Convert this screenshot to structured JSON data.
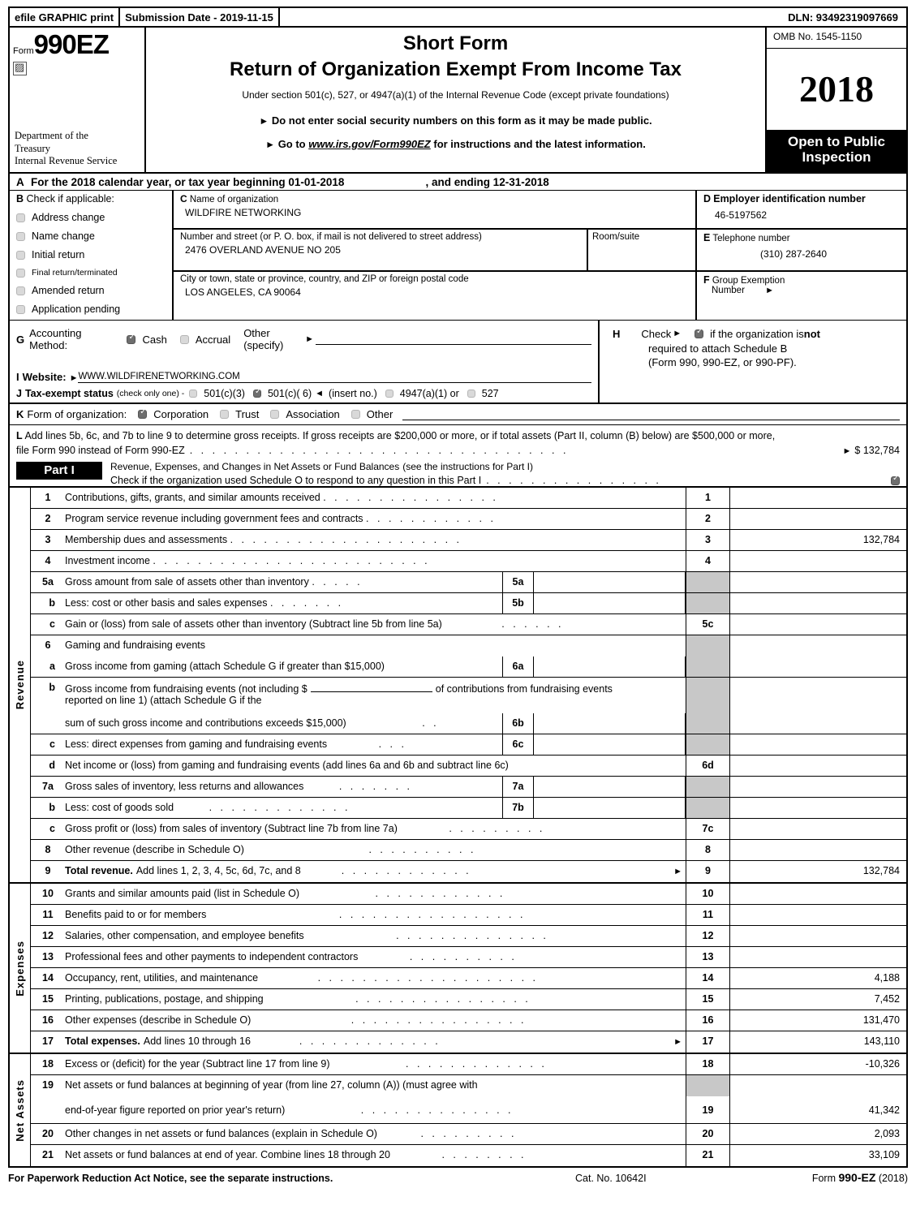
{
  "efile": {
    "print_label": "efile GRAPHIC print",
    "submission": "Submission Date - 2019-11-15",
    "dln": "DLN: 93492319097669"
  },
  "header": {
    "form_label": "Form",
    "form_number": "990EZ",
    "dept_line1": "Department of the",
    "dept_line2": "Treasury",
    "dept_line3": "Internal Revenue Service",
    "title_short": "Short Form",
    "title_main": "Return of Organization Exempt From Income Tax",
    "subtitle": "Under section 501(c), 527, or 4947(a)(1) of the Internal Revenue Code (except private foundations)",
    "bullet1": "Do not enter social security numbers on this form as it may be made public.",
    "bullet2_pre": "Go to ",
    "bullet2_link": "www.irs.gov/Form990EZ",
    "bullet2_post": " for instructions and the latest information.",
    "omb": "OMB No. 1545-1150",
    "year": "2018",
    "open_line1": "Open to Public",
    "open_line2": "Inspection"
  },
  "rowA": {
    "letter": "A",
    "text": "For the 2018 calendar year, or tax year beginning 01-01-2018",
    "ending": ", and ending 12-31-2018"
  },
  "sectionB": {
    "letter": "B",
    "heading": "Check if applicable:",
    "items": [
      {
        "label": "Address change",
        "checked": false
      },
      {
        "label": "Name change",
        "checked": false
      },
      {
        "label": "Initial return",
        "checked": false
      },
      {
        "label": "Final return/terminated",
        "checked": false
      },
      {
        "label": "Amended return",
        "checked": false
      },
      {
        "label": "Application pending",
        "checked": false
      }
    ]
  },
  "sectionC": {
    "letter": "C",
    "name_label": "Name of organization",
    "name_value": "WILDFIRE NETWORKING",
    "street_label": "Number and street (or P. O. box, if mail is not delivered to street address)",
    "street_value": "2476 OVERLAND AVENUE NO 205",
    "room_label": "Room/suite",
    "room_value": "",
    "city_label": "City or town, state or province, country, and ZIP or foreign postal code",
    "city_value": "LOS ANGELES, CA   90064"
  },
  "sectionD": {
    "letter": "D",
    "ein_label": "Employer identification number",
    "ein_value": "46-5197562",
    "phone_letter": "E",
    "phone_label": "Telephone number",
    "phone_value": "(310) 287-2640",
    "group_letter": "F",
    "group_label1": "Group Exemption",
    "group_label2": "Number"
  },
  "sectionG": {
    "letter": "G",
    "label": "Accounting Method:",
    "cash": "Cash",
    "cash_checked": true,
    "accrual": "Accrual",
    "accrual_checked": false,
    "other": "Other (specify)"
  },
  "sectionI": {
    "letter": "I",
    "label": "Website:",
    "value": "WWW.WILDFIRENETWORKING.COM"
  },
  "sectionJ": {
    "letter": "J",
    "label": "Tax-exempt status",
    "note": "(check only one) -",
    "opt1": "501(c)(3)",
    "opt1_checked": false,
    "opt2": "501(c)( 6)",
    "opt2_checked": true,
    "insert": "(insert no.)",
    "opt3": "4947(a)(1) or",
    "opt3_checked": false,
    "opt4": "527",
    "opt4_checked": false
  },
  "sectionH": {
    "letter": "H",
    "check_label": "Check",
    "checked": true,
    "line1_post": "if the organization is ",
    "line1_bold": "not",
    "line2": "required to attach Schedule B",
    "line3": "(Form 990, 990-EZ, or 990-PF)."
  },
  "sectionK": {
    "letter": "K",
    "label": "Form of organization:",
    "options": [
      {
        "label": "Corporation",
        "checked": true
      },
      {
        "label": "Trust",
        "checked": false
      },
      {
        "label": "Association",
        "checked": false
      },
      {
        "label": "Other",
        "checked": false
      }
    ]
  },
  "sectionL": {
    "letter": "L",
    "line1": "Add lines 5b, 6c, and 7b to line 9 to determine gross receipts. If gross receipts are $200,000 or more, or if total assets (Part II, column (B) below) are $500,000 or more,",
    "line2": "file Form 990 instead of Form 990-EZ",
    "amount": "$ 132,784"
  },
  "partI": {
    "label": "Part I",
    "title": "Revenue, Expenses, and Changes in Net Assets or Fund Balances",
    "title_note": "(see the instructions for Part I)",
    "schedule_o": "Check if the organization used Schedule O to respond to any question in this Part I",
    "schedule_o_checked": true,
    "revenue_label": "Revenue",
    "expenses_label": "Expenses",
    "netassets_label": "Net Assets"
  },
  "lines": {
    "revenue": [
      {
        "no": "1",
        "indent": false,
        "text": "Contributions, gifts, grants, and similar amounts received",
        "dots": ". . . . . . . . . . . . . . . .",
        "numcol": "1",
        "value": ""
      },
      {
        "no": "2",
        "indent": false,
        "text": "Program service revenue including government fees and contracts",
        "dots": ". . . . . . . . . . . .",
        "numcol": "2",
        "value": ""
      },
      {
        "no": "3",
        "indent": false,
        "text": "Membership dues and assessments",
        "dots": ". . . . . . . . . . . . . . . . . . . . .",
        "numcol": "3",
        "value": "132,784"
      },
      {
        "no": "4",
        "indent": false,
        "text": "Investment income",
        "dots": ". . . . . . . . . . . . . . . . . . . . . . . . .",
        "numcol": "4",
        "value": ""
      },
      {
        "no": "5a",
        "indent": false,
        "text": "Gross amount from sale of assets other than inventory",
        "dots": ". . . . .",
        "subnum": "5a",
        "subval": "",
        "numcol": "",
        "grey": true,
        "value": ""
      },
      {
        "no": "b",
        "indent": true,
        "text": "Less: cost or other basis and sales expenses",
        "dots": ". . . . . . .",
        "subnum": "5b",
        "subval": "",
        "numcol": "",
        "grey": true,
        "value": ""
      },
      {
        "no": "c",
        "indent": true,
        "text": "Gain or (loss) from sale of assets other than inventory (Subtract line 5b from line 5a)",
        "dots": ". . . . . .",
        "numcol": "5c",
        "value": ""
      },
      {
        "no": "6",
        "indent": false,
        "text": "Gaming and fundraising events",
        "dots": "",
        "numcol": "",
        "grey": true,
        "value": ""
      },
      {
        "no": "a",
        "indent": true,
        "text": "Gross income from gaming (attach Schedule G if greater than $15,000)",
        "dots": "",
        "subnum": "6a",
        "subval": "",
        "numcol": "",
        "grey": true,
        "value": ""
      },
      {
        "no": "b",
        "indent": true,
        "text": "Gross income from fundraising events (not including $ ____ of contributions from fundraising events reported on line 1) (attach Schedule G if the",
        "dots": "",
        "numcol": "",
        "grey": true,
        "value": "",
        "special": "6b-head"
      },
      {
        "no": "",
        "indent": true,
        "text": "sum of such gross income and contributions exceeds $15,000)",
        "dots": ". .",
        "subnum": "6b",
        "subval": "",
        "numcol": "",
        "grey": true,
        "value": ""
      },
      {
        "no": "c",
        "indent": true,
        "text": "Less: direct expenses from gaming and fundraising events",
        "dots": ". . .",
        "subnum": "6c",
        "subval": "",
        "numcol": "",
        "grey": true,
        "value": ""
      },
      {
        "no": "d",
        "indent": true,
        "text": "Net income or (loss) from gaming and fundraising events (add lines 6a and 6b and subtract line 6c)",
        "dots": "",
        "numcol": "6d",
        "value": ""
      },
      {
        "no": "7a",
        "indent": false,
        "text": "Gross sales of inventory, less returns and allowances",
        "dots": ". . . . . . .",
        "subnum": "7a",
        "subval": "",
        "numcol": "",
        "grey": true,
        "value": ""
      },
      {
        "no": "b",
        "indent": true,
        "text": "Less: cost of goods sold",
        "dots": ". . . . . . . . . . . . .",
        "subnum": "7b",
        "subval": "",
        "numcol": "",
        "grey": true,
        "value": ""
      },
      {
        "no": "c",
        "indent": true,
        "text": "Gross profit or (loss) from sales of inventory (Subtract line 7b from line 7a)",
        "dots": ". . . . . . . . .",
        "numcol": "7c",
        "value": ""
      },
      {
        "no": "8",
        "indent": false,
        "text": "Other revenue (describe in Schedule O)",
        "dots": ". . . . . . . . . .",
        "numcol": "8",
        "value": ""
      },
      {
        "no": "9",
        "indent": false,
        "text": "Total revenue. Add lines 1, 2, 3, 4, 5c, 6d, 7c, and 8",
        "bold_prefix": "Total revenue.",
        "dots": ". . . . . . . . . . . .",
        "arrow": true,
        "numcol": "9",
        "value": "132,784"
      }
    ],
    "expenses": [
      {
        "no": "10",
        "text": "Grants and similar amounts paid (list in Schedule O)",
        "dots": ". . . . . . . . . . . .",
        "numcol": "10",
        "value": ""
      },
      {
        "no": "11",
        "text": "Benefits paid to or for members",
        "dots": ". . . . . . . . . . . . . . . . .",
        "numcol": "11",
        "value": ""
      },
      {
        "no": "12",
        "text": "Salaries, other compensation, and employee benefits",
        "dots": ". . . . . . . . . . . . . .",
        "numcol": "12",
        "value": ""
      },
      {
        "no": "13",
        "text": "Professional fees and other payments to independent contractors",
        "dots": ". . . . . . . . . .",
        "numcol": "13",
        "value": ""
      },
      {
        "no": "14",
        "text": "Occupancy, rent, utilities, and maintenance",
        "dots": ". . . . . . . . . . . . . . . . . . . .",
        "numcol": "14",
        "value": "4,188"
      },
      {
        "no": "15",
        "text": "Printing, publications, postage, and shipping",
        "dots": ". . . . . . . . . . . . . . . .",
        "numcol": "15",
        "value": "7,452"
      },
      {
        "no": "16",
        "text": "Other expenses (describe in Schedule O)",
        "dots": ". . . . . . . . . . . . . . . .",
        "numcol": "16",
        "value": "131,470"
      },
      {
        "no": "17",
        "text": "Total expenses. Add lines 10 through 16",
        "bold_prefix": "Total expenses.",
        "dots": ". . . . . . . . . . . . .",
        "arrow": true,
        "numcol": "17",
        "value": "143,110"
      }
    ],
    "netassets": [
      {
        "no": "18",
        "text": "Excess or (deficit) for the year (Subtract line 17 from line 9)",
        "dots": ". . . . . . . . . . . . .",
        "numcol": "18",
        "value": "-10,326"
      },
      {
        "no": "19",
        "text": "Net assets or fund balances at beginning of year (from line 27, column (A)) (must agree with",
        "dots": "",
        "numcol": "",
        "grey": true,
        "value": ""
      },
      {
        "no": "",
        "text": "end-of-year figure reported on prior year's return)",
        "dots": ". . . . . . . . . . . . . .",
        "numcol": "19",
        "value": "41,342"
      },
      {
        "no": "20",
        "text": "Other changes in net assets or fund balances (explain in Schedule O)",
        "dots": ". . . . . . . . .",
        "numcol": "20",
        "value": "2,093"
      },
      {
        "no": "21",
        "text": "Net assets or fund balances at end of year. Combine lines 18 through 20",
        "dots": ". . . . . . . .",
        "numcol": "21",
        "value": "33,109"
      }
    ]
  },
  "footer": {
    "notice": "For Paperwork Reduction Act Notice, see the separate instructions.",
    "cat": "Cat. No. 10642I",
    "form_pre": "Form ",
    "form_name": "990-EZ",
    "form_year": " (2018)"
  }
}
